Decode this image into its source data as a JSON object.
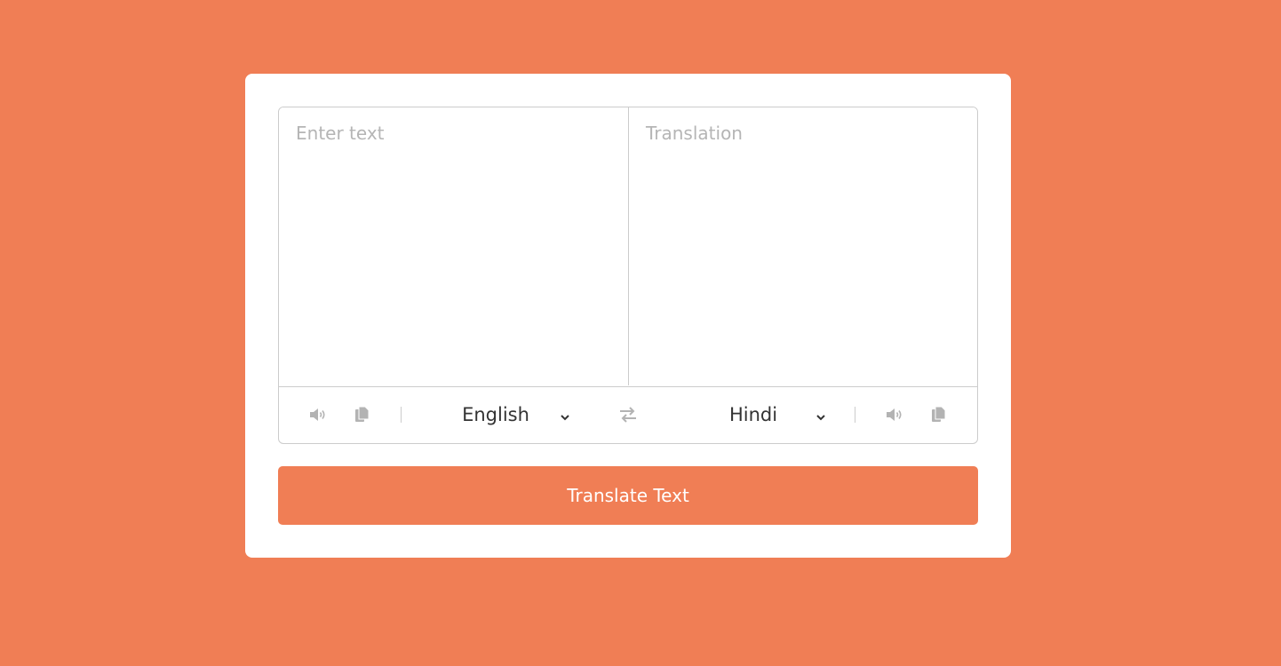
{
  "colors": {
    "background": "#f07e55",
    "card": "#ffffff",
    "button": "#f07e55",
    "icon": "#b3b3b3"
  },
  "from_text": {
    "value": "",
    "placeholder": "Enter text"
  },
  "to_text": {
    "value": "",
    "placeholder": "Translation"
  },
  "controls": {
    "from_icons": [
      "speaker-icon",
      "copy-icon"
    ],
    "from_language": "English",
    "exchange_icon": "exchange-icon",
    "to_language": "Hindi",
    "to_icons": [
      "speaker-icon",
      "copy-icon"
    ]
  },
  "translate_button": {
    "label": "Translate Text"
  }
}
